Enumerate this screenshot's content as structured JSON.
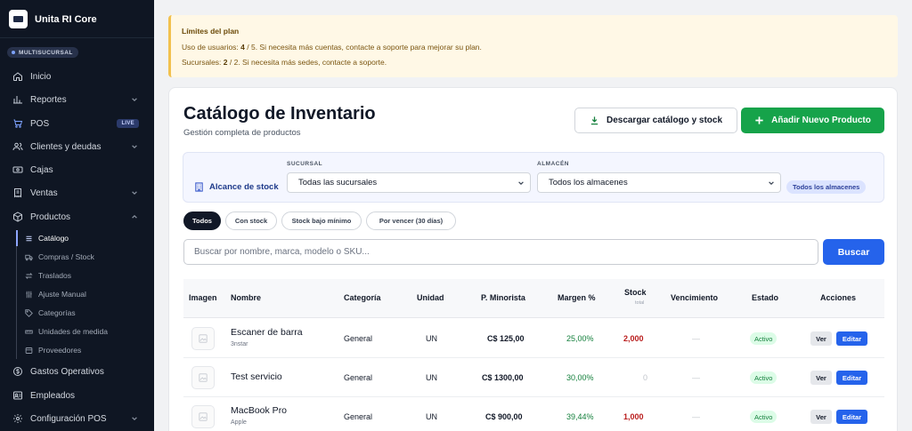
{
  "app": {
    "name": "Unita RI Core",
    "branch_mode": "MULTISUCURSAL"
  },
  "nav": {
    "items": [
      {
        "label": "Inicio",
        "icon": "home-icon"
      },
      {
        "label": "Reportes",
        "icon": "chart-icon"
      },
      {
        "label": "POS",
        "icon": "cart-icon",
        "badge": "LIVE"
      },
      {
        "label": "Clientes y deudas",
        "icon": "users-icon"
      },
      {
        "label": "Cajas",
        "icon": "cash-icon"
      },
      {
        "label": "Ventas",
        "icon": "receipt-icon"
      },
      {
        "label": "Productos",
        "icon": "box-icon"
      }
    ],
    "sub_items": [
      {
        "label": "Catálogo",
        "icon": "list-icon"
      },
      {
        "label": "Compras / Stock",
        "icon": "truck-icon"
      },
      {
        "label": "Traslados",
        "icon": "transfer-icon"
      },
      {
        "label": "Ajuste Manual",
        "icon": "sliders-icon"
      },
      {
        "label": "Categorías",
        "icon": "tag-icon"
      },
      {
        "label": "Unidades de medida",
        "icon": "ruler-icon"
      },
      {
        "label": "Proveedores",
        "icon": "supplier-icon"
      }
    ],
    "bottom_items": [
      {
        "label": "Gastos Operativos",
        "icon": "dollar-icon"
      },
      {
        "label": "Empleados",
        "icon": "employees-icon"
      },
      {
        "label": "Configuración POS",
        "icon": "gear-icon"
      }
    ]
  },
  "alert": {
    "title": "Límites del plan",
    "line1_prefix": "Uso de usuarios: ",
    "line1_used": "4",
    "line1_rest": " / 5. Si necesita más cuentas, contacte a soporte para mejorar su plan.",
    "line2_prefix": "Sucursales: ",
    "line2_used": "2",
    "line2_rest": " / 2. Si necesita más sedes, contacte a soporte."
  },
  "page": {
    "title": "Catálogo de Inventario",
    "subtitle": "Gestión completa de productos",
    "download_label": "Descargar catálogo y stock",
    "add_label": "Añadir Nuevo Producto"
  },
  "scope": {
    "label": "Alcance de stock",
    "branch_label": "SUCURSAL",
    "branch_value": "Todas las sucursales",
    "warehouse_label": "ALMACÉN",
    "warehouse_value": "Todos los almacenes",
    "pill": "Todos los almacenes"
  },
  "filters": [
    "Todos",
    "Con stock",
    "Stock bajo mínimo",
    "Por vencer (30 días)"
  ],
  "search": {
    "placeholder": "Buscar por nombre, marca, modelo o SKU...",
    "button": "Buscar"
  },
  "table": {
    "headers": {
      "image": "Imagen",
      "name": "Nombre",
      "category": "Categoría",
      "unit": "Unidad",
      "price": "P. Minorista",
      "margin": "Margen %",
      "stock": "Stock",
      "stock_sub": "total",
      "expiry": "Vencimiento",
      "status": "Estado",
      "actions": "Acciones"
    },
    "rows": [
      {
        "name": "Escaner de barra",
        "brand": "3nstar",
        "category": "General",
        "unit": "UN",
        "price": "C$ 125,00",
        "margin": "25,00%",
        "stock": "2,000",
        "expiry": "—",
        "status": "Activo",
        "view": "Ver",
        "edit": "Editar"
      },
      {
        "name": "Test servicio",
        "brand": "",
        "category": "General",
        "unit": "UN",
        "price": "C$ 1300,00",
        "margin": "30,00%",
        "stock": "0",
        "expiry": "—",
        "status": "Activo",
        "view": "Ver",
        "edit": "Editar"
      },
      {
        "name": "MacBook Pro",
        "brand": "Apple",
        "category": "General",
        "unit": "UN",
        "price": "C$ 900,00",
        "margin": "39,44%",
        "stock": "1,000",
        "expiry": "—",
        "status": "Activo",
        "view": "Ver",
        "edit": "Editar"
      }
    ]
  },
  "colors": {
    "sidebar": "#0f1623",
    "primary": "#2563eb",
    "success": "#16a34a",
    "warning_bg": "#fff8e6"
  }
}
